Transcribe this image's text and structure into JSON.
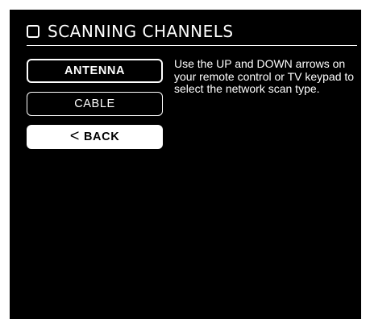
{
  "header": {
    "title": "SCANNING CHANNELS",
    "icon": "square-outline-icon"
  },
  "menu": {
    "items": [
      {
        "label": "ANTENNA",
        "state": "selected"
      },
      {
        "label": "CABLE",
        "state": "normal"
      },
      {
        "label": "BACK",
        "icon": "chevron-left-icon",
        "icon_glyph": "<"
      }
    ]
  },
  "help": {
    "text": "Use the UP and DOWN arrows on your remote control or TV keypad to select the network scan type."
  },
  "colors": {
    "background": "#000000",
    "foreground": "#ffffff",
    "page_border": "#ffffff"
  }
}
